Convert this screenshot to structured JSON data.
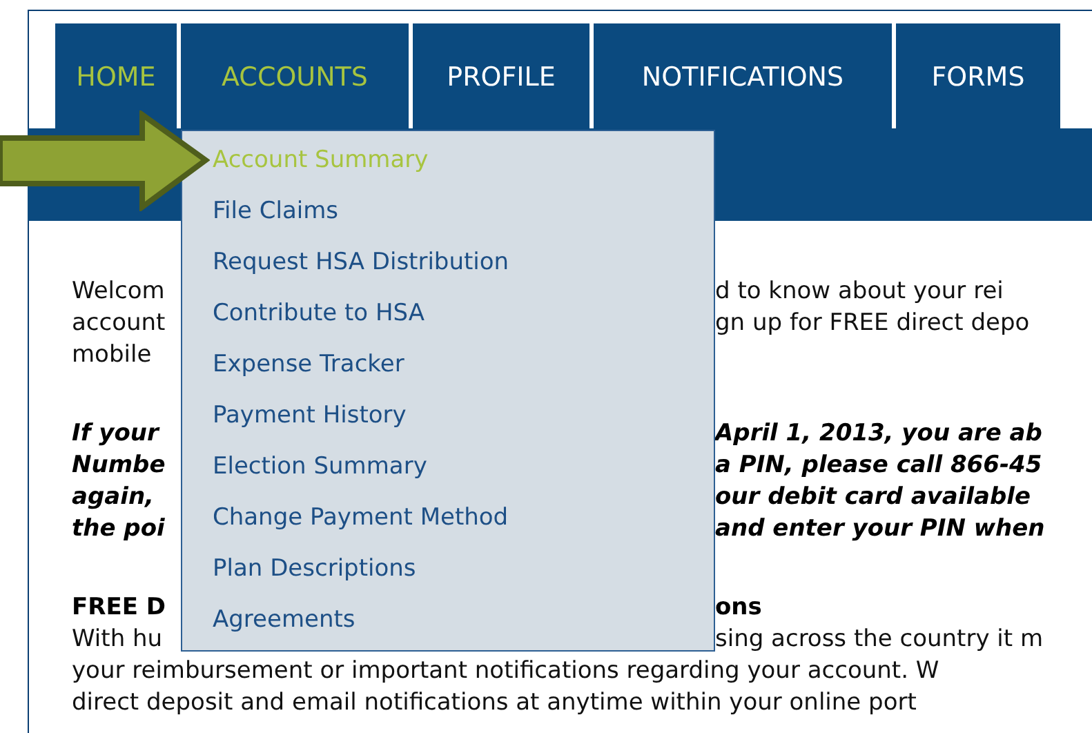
{
  "nav_tabs": [
    {
      "label": "HOME",
      "highlighted": true
    },
    {
      "label": "ACCOUNTS",
      "highlighted": true
    },
    {
      "label": "PROFILE",
      "highlighted": false
    },
    {
      "label": "NOTIFICATIONS",
      "highlighted": false
    },
    {
      "label": "FORMS",
      "highlighted": false
    }
  ],
  "dropdown": {
    "items": [
      {
        "label": "Account Summary",
        "hovered": true
      },
      {
        "label": "File Claims",
        "hovered": false
      },
      {
        "label": "Request HSA Distribution",
        "hovered": false
      },
      {
        "label": "Contribute to HSA",
        "hovered": false
      },
      {
        "label": "Expense Tracker",
        "hovered": false
      },
      {
        "label": "Payment History",
        "hovered": false
      },
      {
        "label": "Election Summary",
        "hovered": false
      },
      {
        "label": "Change Payment Method",
        "hovered": false
      },
      {
        "label": "Plan Descriptions",
        "hovered": false
      },
      {
        "label": "Agreements",
        "hovered": false
      }
    ]
  },
  "content_lines": [
    {
      "kind": "normal",
      "left": "Welcom",
      "right": "d to know about your rei"
    },
    {
      "kind": "normal",
      "left": "account",
      "right": "gn up for FREE direct depo"
    },
    {
      "kind": "normal",
      "left": "mobile"
    },
    {
      "kind": "gap"
    },
    {
      "kind": "emphasis",
      "left": "If your",
      "right": "April 1, 2013, you are ab"
    },
    {
      "kind": "emphasis",
      "left": "Numbe",
      "right": "a PIN, please call 866-45"
    },
    {
      "kind": "emphasis",
      "left": "again,",
      "right": "our debit card available"
    },
    {
      "kind": "emphasis",
      "left": "the poi",
      "right": "and enter your PIN when"
    },
    {
      "kind": "gap"
    },
    {
      "kind": "heading",
      "left": "FREE D",
      "right": "ons"
    },
    {
      "kind": "normal",
      "left": "With hu",
      "right": "sing across the country it m"
    },
    {
      "kind": "normal",
      "left": "your reimbursement or important notifications regarding your account. W"
    },
    {
      "kind": "normal",
      "left": "direct deposit and email notifications at anytime within your online port"
    }
  ]
}
